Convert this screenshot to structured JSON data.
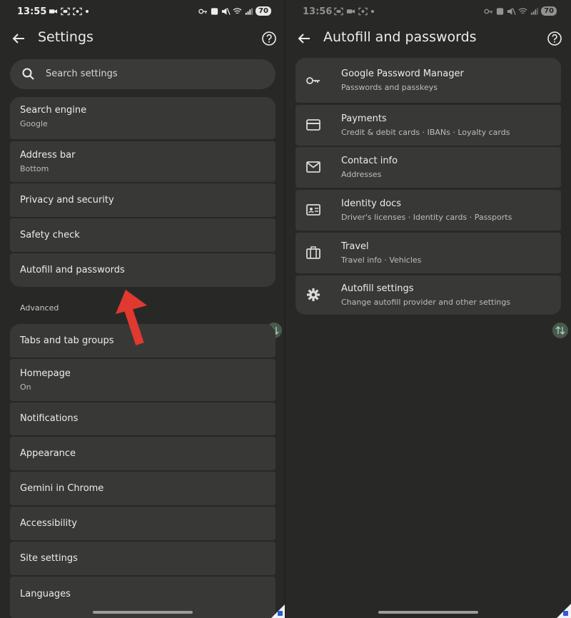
{
  "left": {
    "status": {
      "time": "13:55",
      "battery": "70"
    },
    "title": "Settings",
    "search_placeholder": "Search settings",
    "items": [
      {
        "title": "Search engine",
        "subtitle": "Google"
      },
      {
        "title": "Address bar",
        "subtitle": "Bottom"
      },
      {
        "title": "Privacy and security",
        "subtitle": ""
      },
      {
        "title": "Safety check",
        "subtitle": ""
      },
      {
        "title": "Autofill and passwords",
        "subtitle": ""
      }
    ],
    "advanced_label": "Advanced",
    "advanced_items": [
      {
        "title": "Tabs and tab groups",
        "subtitle": ""
      },
      {
        "title": "Homepage",
        "subtitle": "On"
      },
      {
        "title": "Notifications",
        "subtitle": ""
      },
      {
        "title": "Appearance",
        "subtitle": ""
      },
      {
        "title": "Gemini in Chrome",
        "subtitle": ""
      },
      {
        "title": "Accessibility",
        "subtitle": ""
      },
      {
        "title": "Site settings",
        "subtitle": ""
      },
      {
        "title": "Languages",
        "subtitle": ""
      }
    ]
  },
  "right": {
    "status": {
      "time": "13:56",
      "battery": "70"
    },
    "title": "Autofill and passwords",
    "items": [
      {
        "icon": "key-icon",
        "title": "Google Password Manager",
        "subtitle": "Passwords and passkeys"
      },
      {
        "icon": "credit-card-icon",
        "title": "Payments",
        "subtitle": "Credit & debit cards · IBANs · Loyalty cards"
      },
      {
        "icon": "mail-icon",
        "title": "Contact info",
        "subtitle": "Addresses"
      },
      {
        "icon": "id-card-icon",
        "title": "Identity docs",
        "subtitle": "Driver's licenses · Identity cards · Passports"
      },
      {
        "icon": "briefcase-icon",
        "title": "Travel",
        "subtitle": "Travel info · Vehicles"
      },
      {
        "icon": "gear-icon",
        "title": "Autofill settings",
        "subtitle": "Change autofill provider and other settings"
      }
    ]
  },
  "colors": {
    "background": "#282927",
    "card": "#383936",
    "arrow": "#e0392f"
  }
}
